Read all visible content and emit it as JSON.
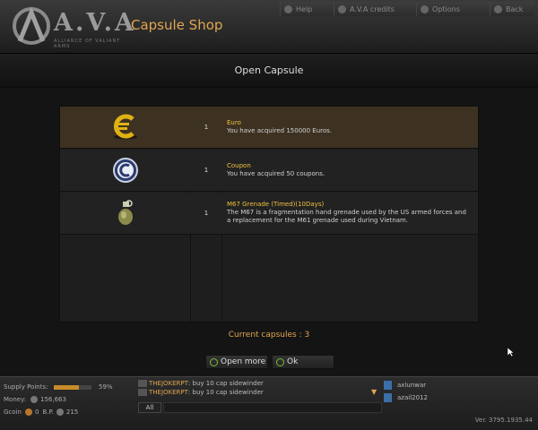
{
  "header": {
    "logo_text": "A.V.A",
    "logo_subtitle": "ALLIANCE OF VALIANT ARMS",
    "page_title": "Capsule Shop",
    "menu": [
      {
        "label": "Help",
        "icon": "help-icon"
      },
      {
        "label": "A.V.A credits",
        "icon": "credits-icon"
      },
      {
        "label": "Options",
        "icon": "gear-icon"
      },
      {
        "label": "Back",
        "icon": "back-icon"
      }
    ]
  },
  "modal": {
    "title": "Open Capsule",
    "rows": [
      {
        "icon": "euro-icon",
        "qty": "1",
        "name": "Euro",
        "text": "You have acquired 150000 Euros."
      },
      {
        "icon": "coupon-icon",
        "qty": "1",
        "name": "Coupon",
        "text": "You have acquired 50 coupons."
      },
      {
        "icon": "grenade-icon",
        "qty": "1",
        "name": "M67 Grenade (Timed)(10Days)",
        "text": "The M67 is a fragmentation hand grenade used by the US armed forces and a replacement for the M61 grenade used during Vietnam."
      }
    ],
    "current_capsules": "Current capsules : 3",
    "buttons": {
      "open_more": "Open more",
      "ok": "Ok"
    }
  },
  "status": {
    "supply_points_label": "Supply Points:",
    "supply_points_value": "59%",
    "supply_points_fraction": 0.59,
    "money_label": "Money:",
    "money_value": "156,663",
    "gcoin_label": "Gcoin",
    "gcoin_value": "0",
    "bp_label": "B.P.",
    "bp_value": "215"
  },
  "chat": {
    "messages": [
      {
        "user": "THEJOKERPT",
        "text": " : buy 10 cap sidewinder"
      },
      {
        "user": "THEJOKERPT",
        "text": " : buy 10 cap sidewinder"
      }
    ],
    "scope": "All"
  },
  "friends": [
    "axlunwar",
    "azail2012"
  ],
  "version": "Ver. 3795.1935.44",
  "colors": {
    "accent": "#e0a550",
    "item_name": "#f0c23c",
    "selected_row": "#3d3222"
  }
}
